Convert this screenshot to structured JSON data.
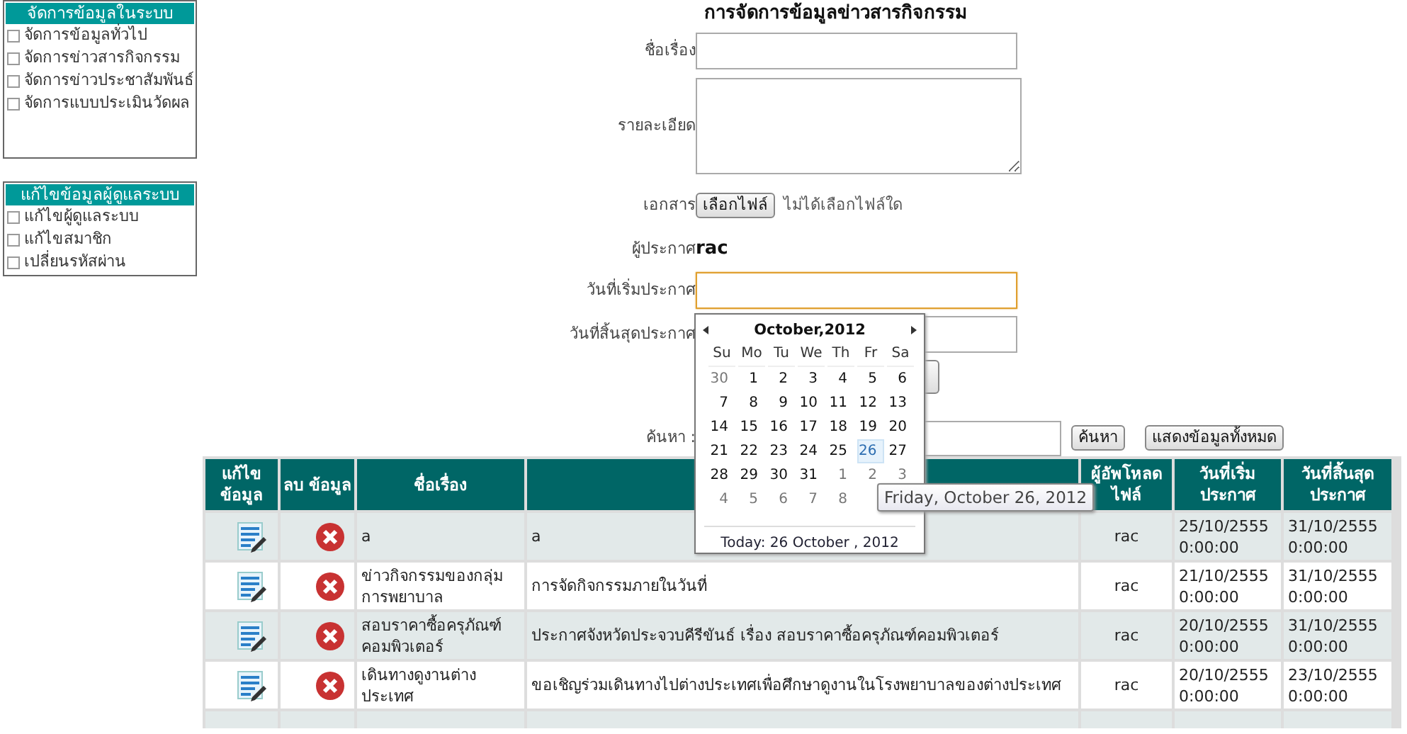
{
  "sidebar": [
    {
      "title": "จัดการข้อมูลในระบบ",
      "items": [
        "จัดการข้อมูลทั่วไป",
        "จัดการข่าวสารกิจกรรม",
        "จัดการข่าวประชาสัมพันธ์",
        "จัดการแบบประเมินวัดผล"
      ]
    },
    {
      "title": "แก้ไขข้อมูลผู้ดูแลระบบ",
      "items": [
        "แก้ไขผู้ดูแลระบบ",
        "แก้ไขสมาชิก",
        "เปลี่ยนรหัสผ่าน"
      ]
    }
  ],
  "form": {
    "title": "การจัดการข้อมูลข่าวสารกิจกรรม",
    "fields": [
      {
        "kind": "text",
        "label": "ชื่อเรื่อง",
        "focused": false
      },
      {
        "kind": "textarea",
        "label": "รายละเอียด"
      },
      {
        "kind": "file",
        "label": "เอกสาร",
        "button": "เลือกไฟล์",
        "note": "ไม่ได้เลือกไฟล์ใด"
      },
      {
        "kind": "static",
        "label": "ผู้ประกาศ",
        "value": "rac"
      },
      {
        "kind": "text",
        "label": "วันที่เริ่มประกาศ",
        "focused": true
      },
      {
        "kind": "text",
        "label": "วันที่สิ้นสุดประกาศ",
        "focused": false
      },
      {
        "kind": "button"
      }
    ],
    "search": {
      "label": "ค้นหา :",
      "button": "ค้นหา",
      "show_all": "แสดงข้อมูลทั้งหมด"
    }
  },
  "table": {
    "columns": [
      "แก้ไข ข้อมูล",
      "ลบ ข้อมูล",
      "ชื่อเรื่อง",
      null,
      "ผู้อัพโหลด ไฟล์",
      "วันที่เริ่ม ประกาศ",
      "วันที่สิ้นสุด ประกาศ"
    ],
    "rows": [
      {
        "title": "a",
        "detail": "a",
        "uploader": "rac",
        "start": "25/10/2555 0:00:00",
        "end": "31/10/2555 0:00:00"
      },
      {
        "title": "ข่าวกิจกรรมของกลุ่ม การพยาบาล",
        "detail": "การจัดกิจกรรมภายในวันที่",
        "uploader": "rac",
        "start": "21/10/2555 0:00:00",
        "end": "31/10/2555 0:00:00"
      },
      {
        "title": "สอบราคาซื้อครุภัณฑ์ คอมพิวเตอร์",
        "detail": "ประกาศจังหวัดประจวบคีรีขันธ์ เรื่อง สอบราคาซื้อครุภัณฑ์คอมพิวเตอร์",
        "uploader": "rac",
        "start": "20/10/2555 0:00:00",
        "end": "31/10/2555 0:00:00"
      },
      {
        "title": "เดินทางดูงานต่าง ประเทศ",
        "detail": "ขอเชิญร่วมเดินทางไปต่างประเทศเพื่อศึกษาดูงานในโรงพยาบาลของต่างประเทศ",
        "uploader": "rac",
        "start": "20/10/2555 0:00:00",
        "end": "23/10/2555 0:00:00"
      }
    ]
  },
  "calendar": {
    "month": "October,2012",
    "weekdays": [
      "Su",
      "Mo",
      "Tu",
      "We",
      "Th",
      "Fr",
      "Sa"
    ],
    "weeks": [
      [
        {
          "day": "30",
          "other_month": true,
          "selected": false
        },
        {
          "day": "1",
          "other_month": false,
          "selected": false
        },
        {
          "day": "2",
          "other_month": false,
          "selected": false
        },
        {
          "day": "3",
          "other_month": false,
          "selected": false
        },
        {
          "day": "4",
          "other_month": false,
          "selected": false
        },
        {
          "day": "5",
          "other_month": false,
          "selected": false
        },
        {
          "day": "6",
          "other_month": false,
          "selected": false
        }
      ],
      [
        {
          "day": "7",
          "other_month": false,
          "selected": false
        },
        {
          "day": "8",
          "other_month": false,
          "selected": false
        },
        {
          "day": "9",
          "other_month": false,
          "selected": false
        },
        {
          "day": "10",
          "other_month": false,
          "selected": false
        },
        {
          "day": "11",
          "other_month": false,
          "selected": false
        },
        {
          "day": "12",
          "other_month": false,
          "selected": false
        },
        {
          "day": "13",
          "other_month": false,
          "selected": false
        }
      ],
      [
        {
          "day": "14",
          "other_month": false,
          "selected": false
        },
        {
          "day": "15",
          "other_month": false,
          "selected": false
        },
        {
          "day": "16",
          "other_month": false,
          "selected": false
        },
        {
          "day": "17",
          "other_month": false,
          "selected": false
        },
        {
          "day": "18",
          "other_month": false,
          "selected": false
        },
        {
          "day": "19",
          "other_month": false,
          "selected": false
        },
        {
          "day": "20",
          "other_month": false,
          "selected": false
        }
      ],
      [
        {
          "day": "21",
          "other_month": false,
          "selected": false
        },
        {
          "day": "22",
          "other_month": false,
          "selected": false
        },
        {
          "day": "23",
          "other_month": false,
          "selected": false
        },
        {
          "day": "24",
          "other_month": false,
          "selected": false
        },
        {
          "day": "25",
          "other_month": false,
          "selected": false
        },
        {
          "day": "26",
          "other_month": false,
          "selected": true
        },
        {
          "day": "27",
          "other_month": false,
          "selected": false
        }
      ],
      [
        {
          "day": "28",
          "other_month": false,
          "selected": false
        },
        {
          "day": "29",
          "other_month": false,
          "selected": false
        },
        {
          "day": "30",
          "other_month": false,
          "selected": false
        },
        {
          "day": "31",
          "other_month": false,
          "selected": false
        },
        {
          "day": "1",
          "other_month": true,
          "selected": false
        },
        {
          "day": "2",
          "other_month": true,
          "selected": false
        },
        {
          "day": "3",
          "other_month": true,
          "selected": false
        }
      ],
      [
        {
          "day": "4",
          "other_month": true,
          "selected": false
        },
        {
          "day": "5",
          "other_month": true,
          "selected": false
        },
        {
          "day": "6",
          "other_month": true,
          "selected": false
        },
        {
          "day": "7",
          "other_month": true,
          "selected": false
        },
        {
          "day": "8",
          "other_month": true,
          "selected": false
        }
      ]
    ],
    "today": "Today: 26 October , 2012",
    "tooltip": "Friday, October 26, 2012"
  }
}
